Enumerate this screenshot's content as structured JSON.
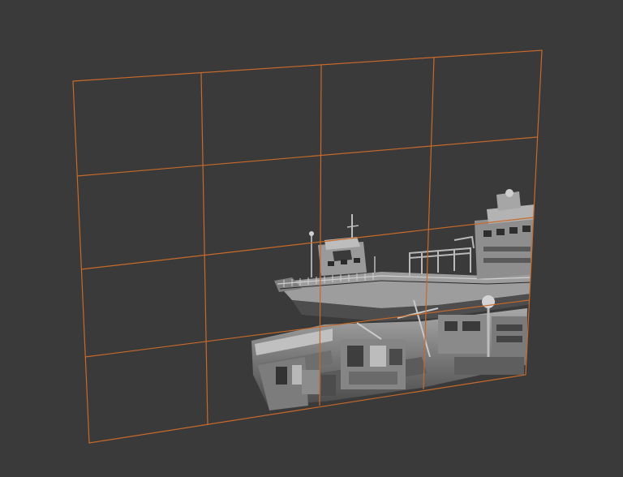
{
  "viewport": {
    "background_color": "#3a3a3a",
    "grid_color": "#c86a2a",
    "grid_divisions": {
      "columns": 4,
      "rows": 4
    },
    "model": {
      "shading": "grey-solid",
      "model_color": "#9a9a9a",
      "shadow_color": "#1d1d1d",
      "highlight_color": "#d8d8d8"
    }
  }
}
